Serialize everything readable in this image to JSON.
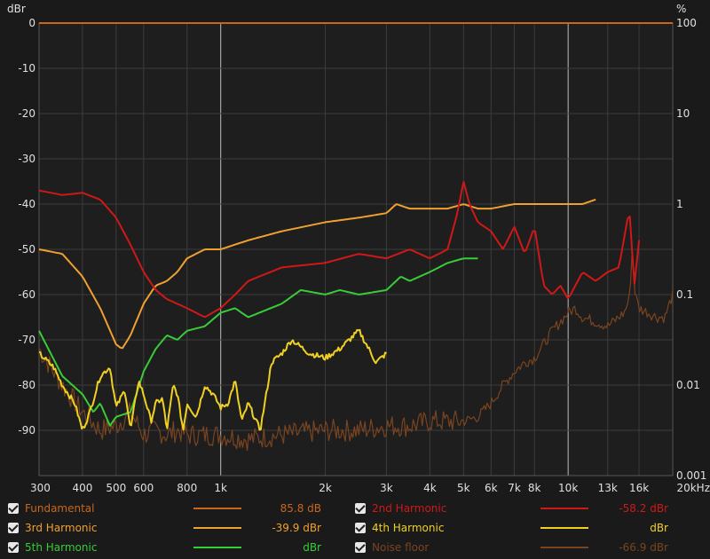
{
  "chart_data": {
    "type": "line",
    "x_scale": "log",
    "xlim": [
      300,
      20000
    ],
    "ylim": [
      -100,
      0
    ],
    "ylabel": "dBr",
    "y2label": "%",
    "x_ticks": [
      "300",
      "400",
      "500",
      "600",
      "800",
      "1k",
      "2k",
      "3k",
      "4k",
      "5k",
      "6k",
      "7k",
      "8k",
      "10k",
      "13k",
      "16k",
      "20kHz"
    ],
    "x_tick_values": [
      300,
      400,
      500,
      600,
      800,
      1000,
      2000,
      3000,
      4000,
      5000,
      6000,
      7000,
      8000,
      10000,
      13000,
      16000,
      20000
    ],
    "y_ticks": [
      "0",
      "-10",
      "-20",
      "-30",
      "-40",
      "-50",
      "-60",
      "-70",
      "-80",
      "-90"
    ],
    "y_tick_values": [
      0,
      -10,
      -20,
      -30,
      -40,
      -50,
      -60,
      -70,
      -80,
      -90
    ],
    "y2_ticks": [
      "100",
      "10",
      "1",
      "0.1",
      "0.01",
      "0.001"
    ],
    "y2_tick_values": [
      0,
      -20,
      -40,
      -60,
      -80,
      -100
    ],
    "grid": true,
    "series": [
      {
        "name": "Fundamental",
        "color": "#c8661e",
        "style": "flat",
        "x": [
          300,
          20000
        ],
        "y": [
          0,
          0
        ]
      },
      {
        "name": "Noise floor",
        "color": "#7a4420",
        "style": "noise",
        "x": [
          300,
          350,
          400,
          450,
          500,
          550,
          600,
          650,
          700,
          750,
          800,
          900,
          1000,
          1200,
          1500,
          2000,
          2500,
          3000,
          3500,
          4000,
          4500,
          5000,
          5500,
          6000,
          6500,
          7000,
          7500,
          8000,
          8500,
          9000,
          9500,
          10000,
          10500,
          11000,
          12000,
          13000,
          14000,
          14500,
          15000,
          15300,
          15600,
          16000,
          17000,
          18000,
          19000,
          20000
        ],
        "y": [
          -72,
          -80,
          -86,
          -90,
          -89,
          -86,
          -91,
          -90,
          -91,
          -90,
          -91,
          -91,
          -91,
          -92,
          -91,
          -90,
          -90,
          -89,
          -89,
          -88,
          -88,
          -88,
          -87,
          -84,
          -80,
          -77,
          -75,
          -74,
          -71,
          -68,
          -66,
          -64,
          -63,
          -65,
          -66,
          -67,
          -65,
          -64,
          -61,
          -50,
          -60,
          -63,
          -64,
          -65,
          -65,
          -60
        ]
      },
      {
        "name": "3rd Harmonic",
        "color": "#f0a030",
        "style": "smooth",
        "x": [
          300,
          350,
          400,
          450,
          500,
          520,
          550,
          600,
          650,
          700,
          750,
          800,
          900,
          1000,
          1200,
          1500,
          2000,
          2500,
          3000,
          3200,
          3500,
          4000,
          4500,
          5000,
          5500,
          6000,
          7000,
          8000,
          9000,
          10000,
          11000,
          12000
        ],
        "y": [
          -50,
          -51,
          -56,
          -63,
          -71,
          -72,
          -69,
          -62,
          -58,
          -57,
          -55,
          -52,
          -50,
          -50,
          -48,
          -46,
          -44,
          -43,
          -42,
          -40,
          -41,
          -41,
          -41,
          -40,
          -41,
          -41,
          -40,
          -40,
          -40,
          -40,
          -40,
          -39
        ]
      },
      {
        "name": "2nd Harmonic",
        "color": "#d01818",
        "style": "smooth",
        "x": [
          300,
          350,
          400,
          450,
          500,
          550,
          600,
          650,
          700,
          800,
          900,
          1000,
          1100,
          1200,
          1500,
          2000,
          2500,
          3000,
          3500,
          4000,
          4500,
          4800,
          5000,
          5200,
          5500,
          6000,
          6500,
          7000,
          7500,
          8000,
          8500,
          9000,
          9500,
          10000,
          11000,
          12000,
          13000,
          14000,
          15000,
          15500,
          16000
        ],
        "y": [
          -37,
          -38,
          -37.5,
          -39,
          -43,
          -49,
          -55,
          -59,
          -61,
          -63,
          -65,
          -63,
          -60,
          -57,
          -54,
          -53,
          -51,
          -52,
          -50,
          -52,
          -50,
          -42,
          -35,
          -40,
          -44,
          -46,
          -50,
          -45,
          -51,
          -45,
          -58,
          -60,
          -58,
          -61,
          -55,
          -57,
          -55,
          -54,
          -41,
          -58,
          -48
        ]
      },
      {
        "name": "5th Harmonic",
        "color": "#38cc38",
        "style": "smooth",
        "x": [
          300,
          350,
          400,
          430,
          450,
          480,
          500,
          550,
          600,
          650,
          700,
          750,
          800,
          900,
          1000,
          1100,
          1200,
          1500,
          1700,
          2000,
          2200,
          2500,
          3000,
          3300,
          3500,
          4000,
          4500,
          5000,
          5500
        ],
        "y": [
          -68,
          -78,
          -82,
          -86,
          -84,
          -89,
          -87,
          -86,
          -77,
          -72,
          -69,
          -70,
          -68,
          -67,
          -64,
          -63,
          -65,
          -62,
          -59,
          -60,
          -59,
          -60,
          -59,
          -56,
          -57,
          -55,
          -53,
          -52,
          -52
        ]
      },
      {
        "name": "4th Harmonic",
        "color": "#f0d020",
        "style": "jagged",
        "x": [
          300,
          330,
          350,
          380,
          400,
          420,
          450,
          480,
          500,
          530,
          550,
          580,
          600,
          630,
          650,
          680,
          700,
          730,
          750,
          780,
          800,
          850,
          900,
          950,
          1000,
          1050,
          1100,
          1150,
          1200,
          1300,
          1400,
          1500,
          1600,
          1800,
          2000,
          2200,
          2500,
          2800,
          3000
        ],
        "y": [
          -73,
          -76,
          -80,
          -84,
          -90,
          -86,
          -78,
          -76,
          -85,
          -81,
          -90,
          -79,
          -82,
          -88,
          -84,
          -83,
          -90,
          -80,
          -82,
          -90,
          -84,
          -87,
          -80,
          -82,
          -85,
          -84,
          -79,
          -88,
          -84,
          -90,
          -75,
          -73,
          -70,
          -73,
          -74,
          -72,
          -68,
          -75,
          -73
        ]
      }
    ]
  },
  "legend": {
    "items": [
      {
        "name": "Fundamental",
        "color": "#c8661e",
        "value": "85.8 dB",
        "value_color": "#c8661e",
        "label_color": "#c8661e"
      },
      {
        "name": "2nd Harmonic",
        "color": "#d01818",
        "value": "-58.2 dBr",
        "value_color": "#d01818",
        "label_color": "#d01818"
      },
      {
        "name": "3rd Harmonic",
        "color": "#f0a030",
        "value": "-39.9 dBr",
        "value_color": "#f0a030",
        "label_color": "#f0a030"
      },
      {
        "name": "4th Harmonic",
        "color": "#f0d020",
        "value": "dBr",
        "value_color": "#f0d020",
        "label_color": "#f0d020"
      },
      {
        "name": "5th Harmonic",
        "color": "#38cc38",
        "value": "dBr",
        "value_color": "#38cc38",
        "label_color": "#38cc38"
      },
      {
        "name": "Noise floor",
        "color": "#7a4420",
        "value": "-66.9 dBr",
        "value_color": "#7a4420",
        "label_color": "#7a4420"
      }
    ]
  }
}
